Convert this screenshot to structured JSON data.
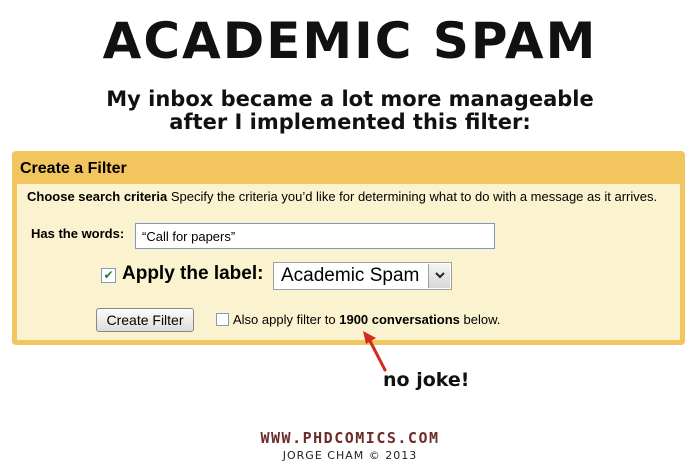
{
  "comic": {
    "title": "ACADEMIC SPAM",
    "caption_line1": "My inbox became a lot more manageable",
    "caption_line2": "after I implemented this filter:",
    "annotation": "no joke!",
    "footer_url": "WWW.PHDCOMICS.COM",
    "footer_credit": "JORGE CHAM © 2013"
  },
  "filter": {
    "header": "Create a Filter",
    "criteria_title": "Choose search criteria",
    "criteria_desc": "Specify the criteria you’d like for determining what to do with a message as it arrives.",
    "has_words_label": "Has the words:",
    "has_words_value": "“Call for papers”",
    "apply_label_checked": true,
    "apply_label_text": "Apply the label:",
    "label_selected": "Academic Spam",
    "create_button": "Create Filter",
    "also_apply_checked": false,
    "also_apply_prefix": "Also apply filter to",
    "also_apply_count": "1900 conversations",
    "also_apply_suffix": "below."
  },
  "colors": {
    "panel_border": "#f3c55e",
    "panel_background": "#fbf3cf",
    "arrow": "#d22c1f",
    "footer_url": "#6b2c2c"
  },
  "icons": {
    "apply_checkbox": "checkmark-icon",
    "select_button": "chevron-down-icon",
    "annotation_arrow": "arrow-icon"
  }
}
